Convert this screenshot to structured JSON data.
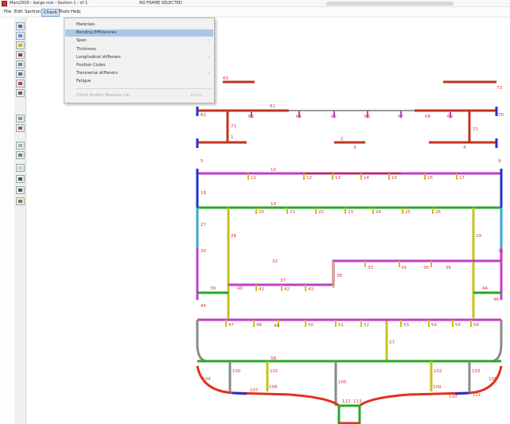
{
  "window": {
    "title": "Mars2000 - barge.mst - Section 1 - of 1",
    "status": "NO FRAME SELECTED"
  },
  "menubar": {
    "items": [
      "File",
      "Edit",
      "Section",
      "Check",
      "Tools",
      "Help"
    ],
    "open_menu": "Check"
  },
  "check_menu": {
    "items": [
      {
        "label": "Materials",
        "has_submenu": false
      },
      {
        "label": "Bending Efficiencies",
        "has_submenu": false,
        "highlighted": true
      },
      {
        "label": "Span",
        "has_submenu": true
      },
      {
        "label": "Thickness",
        "has_submenu": false
      },
      {
        "label": "Longitudinal stiffeners",
        "has_submenu": true
      },
      {
        "label": "Position Codes",
        "has_submenu": false
      },
      {
        "label": "Transverse stiffeners",
        "has_submenu": true
      },
      {
        "label": "Fatigue",
        "has_submenu": false
      }
    ],
    "disabled_item": {
      "label": "Check Builder Modulus List",
      "shortcut": "Ctrl+L"
    }
  },
  "toolbar": {
    "icons": [
      "select-icon",
      "zoom-icon",
      "pan-icon",
      "node-icon",
      "panel-icon",
      "stiffener-icon",
      "girder-icon",
      "frame-icon",
      "print-icon",
      "chart-icon",
      "scale-icon",
      "move-icon",
      "copy-icon",
      "delete-icon",
      "tank-icon",
      "load-icon"
    ]
  },
  "colors": {
    "red": "#e0321e",
    "dark_red": "#c0331f",
    "magenta": "#c23ec8",
    "green": "#28a828",
    "yellow": "#c6c21c",
    "blue": "#2233cc",
    "gray": "#8a8a8a",
    "cyan": "#33aacc",
    "highlight": "#a9c8e8"
  },
  "section_labels": [
    "60",
    "73",
    "61",
    "62",
    "63",
    "64",
    "65",
    "66",
    "67",
    "68",
    "69",
    "70",
    "71",
    "72",
    "1",
    "2",
    "3",
    "4",
    "5",
    "9",
    "10",
    "11",
    "12",
    "13",
    "14",
    "15",
    "16",
    "17",
    "18",
    "19",
    "20",
    "21",
    "22",
    "23",
    "24",
    "25",
    "26",
    "27",
    "28",
    "29",
    "30",
    "31",
    "32",
    "33",
    "34",
    "35",
    "36",
    "37",
    "38",
    "39",
    "40",
    "41",
    "42",
    "43",
    "44",
    "45",
    "46",
    "47",
    "48",
    "49",
    "50",
    "51",
    "52",
    "53",
    "54",
    "55",
    "56",
    "57",
    "58",
    "100",
    "101",
    "102",
    "103",
    "104",
    "105",
    "106",
    "107",
    "108",
    "109",
    "110",
    "111",
    "112",
    "113"
  ]
}
